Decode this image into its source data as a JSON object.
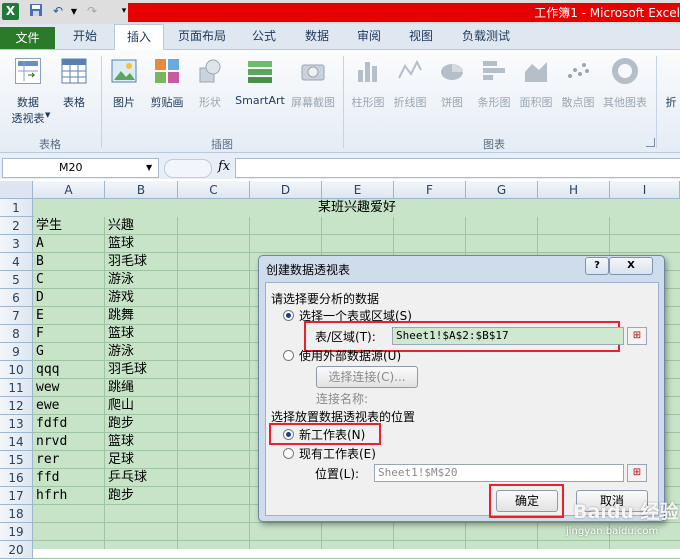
{
  "window": {
    "title": "工作簿1 - Microsoft Excel",
    "app_icon": "excel-icon",
    "quick_access": [
      "save-icon",
      "undo-icon",
      "redo-icon",
      "customize-icon"
    ]
  },
  "tabs": [
    "文件",
    "开始",
    "插入",
    "页面布局",
    "公式",
    "数据",
    "审阅",
    "视图",
    "负载测试"
  ],
  "active_tab": "插入",
  "ribbon": {
    "groups": {
      "tables": {
        "label": "表格",
        "pivot_line1": "数据",
        "pivot_line2": "透视表",
        "table": "表格"
      },
      "illustrations": {
        "label": "插图",
        "picture": "图片",
        "clipart": "剪贴画",
        "shapes": "形状",
        "smartart": "SmartArt",
        "screenshot": "屏幕截图"
      },
      "charts": {
        "label": "图表",
        "items": [
          "柱形图",
          "折线图",
          "饼图",
          "条形图",
          "面积图",
          "散点图",
          "其他图表"
        ]
      },
      "sparklines": {
        "label": "折"
      }
    }
  },
  "formula_bar": {
    "name_box": "M20",
    "fx": "fx",
    "value": ""
  },
  "sheet": {
    "columns": [
      "A",
      "B",
      "C",
      "D",
      "E",
      "F",
      "G",
      "H",
      "I"
    ],
    "rows": [
      "1",
      "2",
      "3",
      "4",
      "5",
      "6",
      "7",
      "8",
      "9",
      "10",
      "11",
      "12",
      "13",
      "14",
      "15",
      "16",
      "17",
      "18",
      "19",
      "20"
    ],
    "title": "某班兴趣爱好",
    "data": [
      [
        "学生",
        "兴趣"
      ],
      [
        "A",
        "篮球"
      ],
      [
        "B",
        "羽毛球"
      ],
      [
        "C",
        "游泳"
      ],
      [
        "D",
        "游戏"
      ],
      [
        "E",
        "跳舞"
      ],
      [
        "F",
        "篮球"
      ],
      [
        "G",
        "游泳"
      ],
      [
        "qqq",
        "羽毛球"
      ],
      [
        "wew",
        "跳绳"
      ],
      [
        "ewe",
        "爬山"
      ],
      [
        "fdfd",
        "跑步"
      ],
      [
        "nrvd",
        "篮球"
      ],
      [
        "rer",
        "足球"
      ],
      [
        "ffd",
        "乒乓球"
      ],
      [
        "hfrh",
        "跑步"
      ]
    ]
  },
  "dialog": {
    "title": "创建数据透视表",
    "help": "?",
    "close": "X",
    "section1": "请选择要分析的数据",
    "opt_table": "选择一个表或区域(S)",
    "range_label": "表/区域(T):",
    "range_value": "Sheet1!$A$2:$B$17",
    "opt_external": "使用外部数据源(U)",
    "choose_conn": "选择连接(C)...",
    "conn_name": "连接名称:",
    "section2": "选择放置数据透视表的位置",
    "opt_new": "新工作表(N)",
    "opt_existing": "现有工作表(E)",
    "location_label": "位置(L):",
    "location_value": "Sheet1!$M$20",
    "ok": "确定",
    "cancel": "取消"
  },
  "watermark": "Baidu 经验",
  "watermark_url": "jingyan.baidu.com"
}
